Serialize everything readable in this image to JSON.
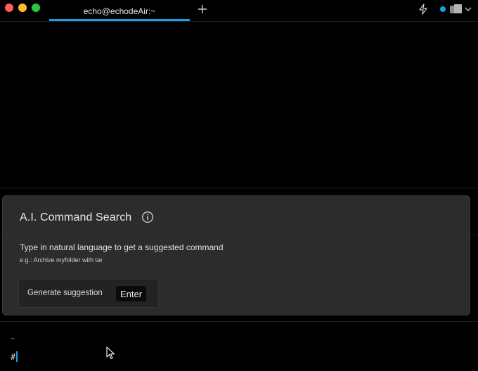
{
  "window": {
    "tab_title": "echo@echodeAir:~"
  },
  "colors": {
    "accent": "#1a9fe8",
    "traffic_close": "#ff5f57",
    "traffic_minimize": "#febc2e",
    "traffic_maximize": "#28c840",
    "prompt_dir": "#d76bd0"
  },
  "icons": {
    "new_tab": "plus-icon",
    "ai": "lightning-bolt-icon",
    "status": "status-dot-icon",
    "panes": "panes-icon",
    "menu": "chevron-down-icon",
    "info": "info-icon",
    "pointer": "mouse-pointer-icon"
  },
  "ai_search": {
    "title": "A.I. Command Search",
    "description": "Type in natural language to get a suggested command",
    "example": "e.g.: Archive myfolder with tar",
    "generate_label": "Generate suggestion",
    "enter_key": "Enter"
  },
  "prompt": {
    "directory": "~",
    "symbol": "#"
  }
}
